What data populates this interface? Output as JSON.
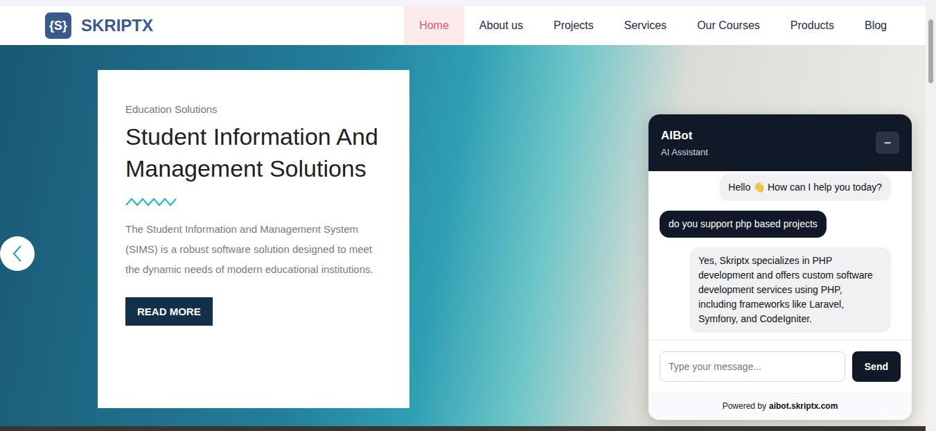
{
  "logo": {
    "mark": "{S}",
    "name": "SKRIPTX"
  },
  "nav": [
    {
      "label": "Home",
      "selected": true
    },
    {
      "label": "About us",
      "selected": false
    },
    {
      "label": "Projects",
      "selected": false
    },
    {
      "label": "Services",
      "selected": false
    },
    {
      "label": "Our Courses",
      "selected": false
    },
    {
      "label": "Products",
      "selected": false
    },
    {
      "label": "Blog",
      "selected": false
    }
  ],
  "hero": {
    "eyebrow": "Education Solutions",
    "title": "Student Information And Management Solutions",
    "body": "The Student Information and Management System (SIMS) is a robust software solution designed to meet the dynamic needs of modern educational institutions.",
    "button": "READ MORE"
  },
  "chat": {
    "title": "AIBot",
    "subtitle": "AI Assistant",
    "minimize": "−",
    "messages": [
      {
        "from": "bot",
        "text": "Hello 👋 How can I help you today?"
      },
      {
        "from": "user",
        "text": "do you support php based projects"
      },
      {
        "from": "bot",
        "text": "Yes, Skriptx specializes in PHP development and offers custom software development services using PHP, including frameworks like Laravel, Symfony, and CodeIgniter."
      }
    ],
    "input": {
      "placeholder": "Type your message..."
    },
    "send": "Send",
    "footer": {
      "prefix": "Powered by",
      "link": "aibot.skriptx.com"
    }
  }
}
